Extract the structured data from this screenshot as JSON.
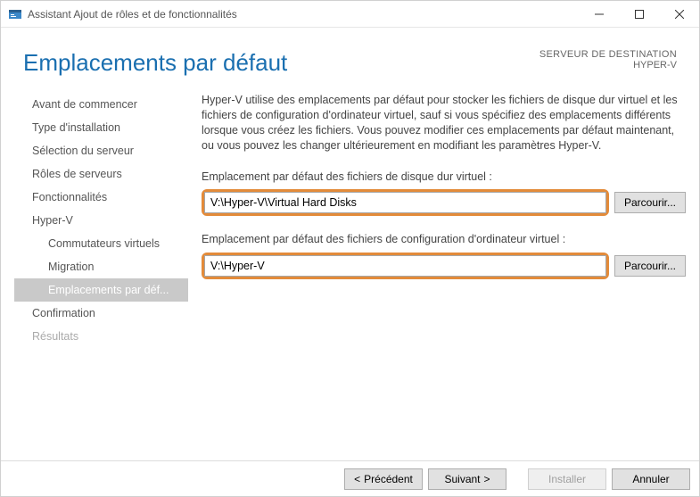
{
  "window": {
    "title": "Assistant Ajout de rôles et de fonctionnalités"
  },
  "page": {
    "title": "Emplacements par défaut",
    "destination_label": "SERVEUR DE DESTINATION",
    "destination_value": "HYPER-V"
  },
  "nav": {
    "items": [
      {
        "label": "Avant de commencer"
      },
      {
        "label": "Type d'installation"
      },
      {
        "label": "Sélection du serveur"
      },
      {
        "label": "Rôles de serveurs"
      },
      {
        "label": "Fonctionnalités"
      },
      {
        "label": "Hyper-V"
      },
      {
        "label": "Commutateurs virtuels"
      },
      {
        "label": "Migration"
      },
      {
        "label": "Emplacements par déf..."
      },
      {
        "label": "Confirmation"
      },
      {
        "label": "Résultats"
      }
    ]
  },
  "content": {
    "intro": "Hyper-V utilise des emplacements par défaut pour stocker les fichiers de disque dur virtuel et les fichiers de configuration d'ordinateur virtuel, sauf si vous spécifiez des emplacements différents lorsque vous créez les fichiers. Vous pouvez modifier ces emplacements par défaut maintenant, ou vous pouvez les changer ultérieurement en modifiant les paramètres Hyper-V.",
    "vhd_label": "Emplacement par défaut des fichiers de disque dur virtuel :",
    "vhd_value": "V:\\Hyper-V\\Virtual Hard Disks",
    "vm_label": "Emplacement par défaut des fichiers de configuration d'ordinateur virtuel :",
    "vm_value": "V:\\Hyper-V",
    "browse": "Parcourir..."
  },
  "footer": {
    "previous": "Précédent",
    "next": "Suivant",
    "install": "Installer",
    "cancel": "Annuler"
  }
}
